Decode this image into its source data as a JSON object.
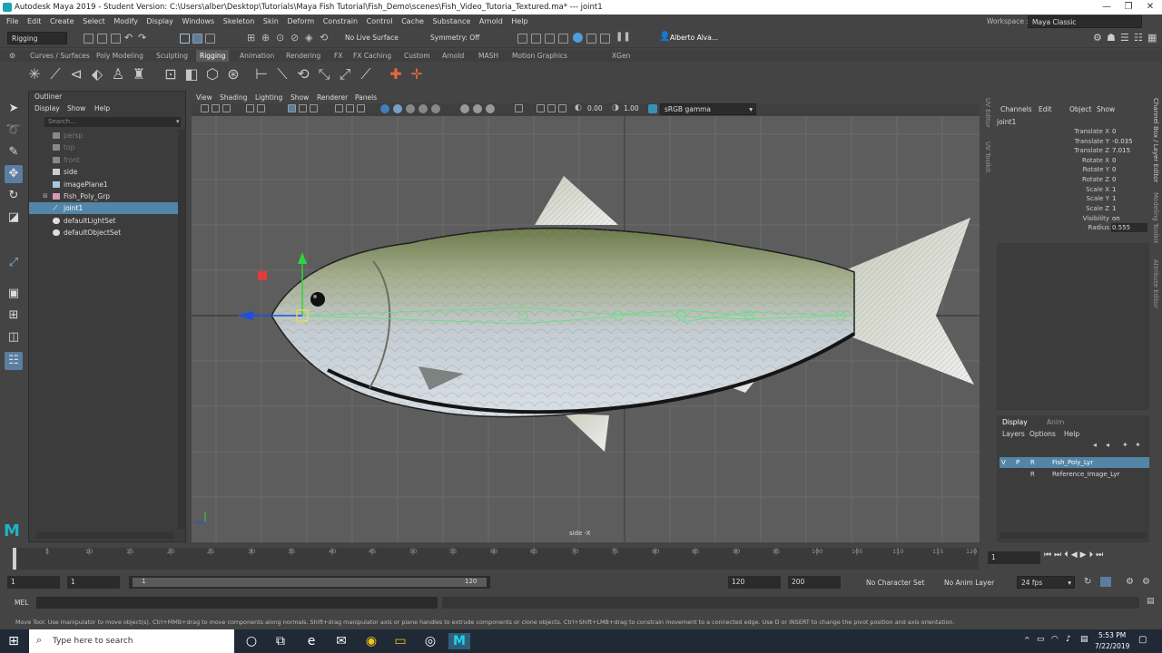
{
  "window": {
    "title": "Autodesk Maya 2019 - Student Version: C:\\Users\\alber\\Desktop\\Tutorials\\Maya Fish Tutorial\\Fish_Demo\\scenes\\Fish_Video_Tutoria_Textured.ma*   ---   joint1",
    "minimize": "—",
    "maximize": "❐",
    "close": "✕"
  },
  "menubar": [
    "File",
    "Edit",
    "Create",
    "Select",
    "Modify",
    "Display",
    "Windows",
    "Skeleton",
    "Skin",
    "Deform",
    "Constrain",
    "Control",
    "Cache",
    "Substance",
    "Arnold",
    "Help"
  ],
  "workspace": {
    "label": "Workspace :",
    "value": "Maya Classic"
  },
  "toolbar": {
    "menuset": "Rigging",
    "live_surface": "No Live Surface",
    "symmetry": "Symmetry: Off",
    "user": "Alberto Alva..."
  },
  "shelf_tabs": [
    "Curves / Surfaces",
    "Poly Modeling",
    "Sculpting",
    "Rigging",
    "Animation",
    "Rendering",
    "FX",
    "FX Caching",
    "Custom",
    "Arnold",
    "MASH",
    "Motion Graphics",
    "XGen"
  ],
  "active_shelf_tab": "Rigging",
  "outliner": {
    "title": "Outliner",
    "menus": [
      "Display",
      "Show",
      "Help"
    ],
    "search_placeholder": "Search...",
    "items": [
      {
        "label": "persp",
        "icon": "camera-icon",
        "dim": true
      },
      {
        "label": "top",
        "icon": "camera-icon",
        "dim": true
      },
      {
        "label": "front",
        "icon": "camera-icon",
        "dim": true
      },
      {
        "label": "side",
        "icon": "camera-icon",
        "dim": false
      },
      {
        "label": "imagePlane1",
        "icon": "image-plane-icon",
        "dim": false
      },
      {
        "label": "Fish_Poly_Grp",
        "icon": "group-icon",
        "dim": false,
        "expandable": true
      },
      {
        "label": "joint1",
        "icon": "joint-icon",
        "dim": false,
        "selected": true
      },
      {
        "label": "defaultLightSet",
        "icon": "set-icon",
        "dim": false
      },
      {
        "label": "defaultObjectSet",
        "icon": "set-icon",
        "dim": false
      }
    ]
  },
  "viewport": {
    "menus": [
      "View",
      "Shading",
      "Lighting",
      "Show",
      "Renderer",
      "Panels"
    ],
    "near_value": "0.00",
    "far_value": "1.00",
    "color_space": "sRGB gamma",
    "camera_label": "side -X"
  },
  "side_tabs": [
    "UV Editor",
    "UV Toolkit"
  ],
  "right_side_tabs": [
    "Channel Box / Layer Editor",
    "Modeling Toolkit",
    "Attribute Editor"
  ],
  "channel_box": {
    "menus": [
      "Channels",
      "Edit",
      "Object",
      "Show"
    ],
    "object": "joint1",
    "channels": [
      {
        "name": "Translate X",
        "value": "0"
      },
      {
        "name": "Translate Y",
        "value": "-0.035"
      },
      {
        "name": "Translate Z",
        "value": "7.015"
      },
      {
        "name": "Rotate X",
        "value": "0"
      },
      {
        "name": "Rotate Y",
        "value": "0"
      },
      {
        "name": "Rotate Z",
        "value": "0"
      },
      {
        "name": "Scale X",
        "value": "1"
      },
      {
        "name": "Scale Y",
        "value": "1"
      },
      {
        "name": "Scale Z",
        "value": "1"
      },
      {
        "name": "Visibility",
        "value": "on"
      },
      {
        "name": "Radius",
        "value": "0.555"
      }
    ]
  },
  "layer_editor": {
    "tabs": [
      "Display",
      "Anim"
    ],
    "active_tab": "Display",
    "menus": [
      "Layers",
      "Options",
      "Help"
    ],
    "layers": [
      {
        "flags": [
          "V",
          "P",
          "R"
        ],
        "name": "Fish_Poly_Lyr",
        "selected": true
      },
      {
        "flags": [
          "",
          "",
          "R"
        ],
        "name": "Reference_Image_Lyr",
        "selected": false
      }
    ]
  },
  "timeline": {
    "ticks": [
      "1",
      "5",
      "10",
      "15",
      "20",
      "25",
      "30",
      "35",
      "40",
      "45",
      "50",
      "55",
      "60",
      "65",
      "70",
      "75",
      "80",
      "85",
      "90",
      "95",
      "100",
      "105",
      "110",
      "115",
      "120"
    ],
    "current_frame": "1"
  },
  "range": {
    "start": "1",
    "playback_start": "1",
    "slider_start": "1",
    "slider_end": "120",
    "playback_end": "120",
    "end": "200",
    "character_set": "No Character Set",
    "anim_layer": "No Anim Layer",
    "fps": "24 fps"
  },
  "command_line": {
    "label": "MEL"
  },
  "help_line": "Move Tool: Use manipulator to move object(s). Ctrl+MMB+drag to move components along normals. Shift+drag manipulator axis or plane handles to extrude components or clone objects. Ctrl+Shift+LMB+drag to constrain movement to a connected edge. Use D or INSERT to change the pivot position and axis orientation.",
  "taskbar": {
    "search_placeholder": "Type here to search",
    "time": "5:53 PM",
    "date": "7/22/2019"
  },
  "colors": {
    "selection": "#5285a6",
    "viewport_bg": "#5d5d5d",
    "joint": "#5fe27a",
    "axis_x": "#e33a3a",
    "axis_y": "#2ed43d",
    "axis_z": "#1d4fe0"
  }
}
